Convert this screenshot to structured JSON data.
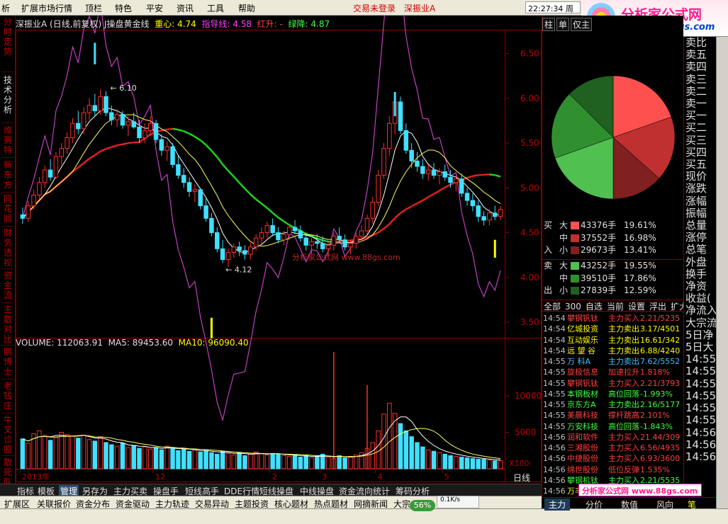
{
  "menu": {
    "items": [
      "析",
      "扩展市场行情",
      "顶栏",
      "特色",
      "平安",
      "资讯",
      "工具",
      "帮助"
    ],
    "trade_status": "交易未登录",
    "stock_label": "深振业A",
    "clock": "22:27:34 周三"
  },
  "logo": {
    "name": "分析家公式网",
    "url": "www.88gs.com"
  },
  "left_tabs": [
    "分时走势",
    "技术分析",
    "维赛特",
    "新东方",
    "同花顺",
    "财务透视",
    "资金流",
    "主散对比",
    "鹏博士",
    "老钱庄",
    "牛叉诊股",
    "散死队",
    "提"
  ],
  "chart_header": {
    "title": "深振业A (日线,前复权) J操盘黄金线",
    "zhongxin_label": "重心:",
    "zhongxin_value": "4.74",
    "zhidao_label": "指导线:",
    "zhidao_value": "4.58",
    "hongsheng_label": "红升:",
    "hongsheng_value": "-",
    "lvjiang_label": "绿降:",
    "lvjiang_value": "4.87"
  },
  "annotations": {
    "high_label": "6.10",
    "low_label": "4.12"
  },
  "watermark": "分析家公式网 www.88gs.com",
  "volume_header": {
    "vol_label": "VOLUME:",
    "vol_value": "112063.91",
    "ma5_label": "MA5:",
    "ma5_value": "89453.60",
    "ma10_label": "MA10:",
    "ma10_value": "96090.40"
  },
  "axis": {
    "price_ticks": [
      "6.50",
      "6.00",
      "5.50",
      "5.00",
      "4.50",
      "4.00",
      "3.50"
    ],
    "volume_ticks": [
      "10000",
      "5000"
    ],
    "volume_unit": "X100",
    "time_labels": [
      "2013年",
      "12",
      "2",
      "3",
      "4",
      "5"
    ],
    "period": "日线"
  },
  "bottom_tabs_1": [
    "指标",
    "模板",
    "管理",
    "另存为",
    "主力买卖",
    "操盘手",
    "短线高手",
    "DDE行情",
    "短线操盘",
    "中线操盘",
    "资金流向统计",
    "筹码分析"
  ],
  "bottom_tabs_1_active": "管理",
  "bottom_tabs_2": [
    "扩展区",
    "关联报价",
    "资金分布",
    "资金驱动",
    "主力轨迹",
    "交易异动",
    "主题投资",
    "核心题材",
    "热点题材",
    "网摘新闻",
    "大宗"
  ],
  "zoom": "56%",
  "net_speed": "0.1K/s",
  "right_tabs": [
    "柱",
    "单",
    "仅主"
  ],
  "flow_buy_side": [
    "买",
    "入"
  ],
  "flow_sell_side": [
    "卖",
    "出"
  ],
  "size_labels": [
    "大",
    "中",
    "小"
  ],
  "flow_buy": [
    {
      "vol": "43376手",
      "pct": "19.61%",
      "color": "#ff5050"
    },
    {
      "vol": "37552手",
      "pct": "16.98%",
      "color": "#c03030"
    },
    {
      "vol": "29673手",
      "pct": "13.41%",
      "color": "#802020"
    }
  ],
  "flow_sell": [
    {
      "vol": "43252手",
      "pct": "19.55%",
      "color": "#50c050"
    },
    {
      "vol": "39510手",
      "pct": "17.86%",
      "color": "#309030"
    },
    {
      "vol": "27839手",
      "pct": "12.59%",
      "color": "#206020"
    }
  ],
  "tick_tabs": [
    "全部",
    "300",
    "自选",
    "当前",
    "设置",
    "浮出",
    "扩大"
  ],
  "ticks": [
    {
      "time": "14:54",
      "name": "攀钢钒钛",
      "type": "主力买入",
      "value": "2.21/5235",
      "color": "#ff4040"
    },
    {
      "time": "14:54",
      "name": "亿城投资",
      "type": "主力卖出",
      "value": "3.17/4501",
      "color": "#ffff00"
    },
    {
      "time": "14:54",
      "name": "互动娱乐",
      "type": "主力卖出",
      "value": "16.61/342",
      "color": "#ffff00"
    },
    {
      "time": "14:54",
      "name": "远 望 谷",
      "type": "主力卖出",
      "value": "6.88/4240",
      "color": "#ffff00"
    },
    {
      "time": "14:55",
      "name": "万  科A",
      "type": "主力卖出",
      "value": "7.62/5552",
      "color": "#40c0ff"
    },
    {
      "time": "14:55",
      "name": "旋极信息",
      "type": "加速拉升",
      "value": "1.818%",
      "color": "#ff4040"
    },
    {
      "time": "14:55",
      "name": "攀钢钒钛",
      "type": "主力买入",
      "value": "2.21/3793",
      "color": "#ff4040"
    },
    {
      "time": "14:55",
      "name": "本钢板材",
      "type": "高位回落",
      "value": "-1.993%",
      "color": "#40ff40"
    },
    {
      "time": "14:55",
      "name": "京东方A",
      "type": "主力卖出",
      "value": "2.16/5177",
      "color": "#40ff40"
    },
    {
      "time": "14:55",
      "name": "美晨科技",
      "type": "撑杆跳高",
      "value": "2.101%",
      "color": "#ff4040"
    },
    {
      "time": "14:55",
      "name": "万安科技",
      "type": "高位回落",
      "value": "-1.843%",
      "color": "#40ff40"
    },
    {
      "time": "14:56",
      "name": "润和软件",
      "type": "主力买入",
      "value": "21.44/309",
      "color": "#ff4040"
    },
    {
      "time": "14:56",
      "name": "三湘股份",
      "type": "主力买入",
      "value": "6.56/4935",
      "color": "#ff4040"
    },
    {
      "time": "14:56",
      "name": "中捷股份",
      "type": "主力买入",
      "value": "6.93/3600",
      "color": "#ff4040"
    },
    {
      "time": "14:56",
      "name": "绵世股份",
      "type": "低位反弹",
      "value": "1.535%",
      "color": "#ff4040"
    },
    {
      "time": "14:56",
      "name": "攀钢机钛",
      "type": "主力买入",
      "value": "2.21/5535",
      "color": "#40ff40"
    },
    {
      "time": "14:56",
      "name": "万丰",
      "type": "",
      "value": "",
      "color": "#ffff00"
    }
  ],
  "far_right_labels": [
    "卖比",
    "卖五",
    "卖四",
    "卖三",
    "卖二",
    "卖一",
    "买一",
    "买二",
    "买三",
    "买四",
    "买五",
    "现价",
    "涨跌",
    "涨幅",
    "振幅",
    "总量",
    "涨停",
    "总笔",
    "外盘",
    "换手",
    "净资",
    "收益(",
    "净流入",
    "大宗流",
    "5日净",
    "5日大",
    "14:55",
    "14:55",
    "14:55",
    "14:55",
    "14:55",
    "14:55",
    "14:56",
    "14:56",
    "14:56"
  ],
  "right_bottom_tabs": [
    "主力",
    "分价",
    "数值",
    "风向",
    "笔"
  ],
  "chart_data": {
    "type": "candlestick",
    "title": "深振业A (日线,前复权) J操盘黄金线",
    "ylim": [
      3.35,
      6.75
    ],
    "candles": [
      [
        4.7,
        4.78,
        4.6,
        4.66
      ],
      [
        4.66,
        4.85,
        4.62,
        4.8
      ],
      [
        4.8,
        4.98,
        4.76,
        4.92
      ],
      [
        4.92,
        5.12,
        4.88,
        5.06
      ],
      [
        5.06,
        5.25,
        5.0,
        5.2
      ],
      [
        5.2,
        5.32,
        5.08,
        5.12
      ],
      [
        5.12,
        5.4,
        5.1,
        5.35
      ],
      [
        5.35,
        5.5,
        5.26,
        5.44
      ],
      [
        5.44,
        5.62,
        5.38,
        5.56
      ],
      [
        5.56,
        5.78,
        5.5,
        5.72
      ],
      [
        5.72,
        5.86,
        5.6,
        5.66
      ],
      [
        5.66,
        5.9,
        5.6,
        5.84
      ],
      [
        5.84,
        6.0,
        5.76,
        5.92
      ],
      [
        5.92,
        6.05,
        5.8,
        5.86
      ],
      [
        5.86,
        6.1,
        5.82,
        6.02
      ],
      [
        6.02,
        6.08,
        5.8,
        5.84
      ],
      [
        5.84,
        5.92,
        5.7,
        5.76
      ],
      [
        5.76,
        5.88,
        5.68,
        5.82
      ],
      [
        5.82,
        5.86,
        5.66,
        5.7
      ],
      [
        5.7,
        5.8,
        5.58,
        5.74
      ],
      [
        5.74,
        5.84,
        5.66,
        5.68
      ],
      [
        5.68,
        5.76,
        5.5,
        5.56
      ],
      [
        5.56,
        5.72,
        5.5,
        5.64
      ],
      [
        5.64,
        5.8,
        5.58,
        5.72
      ],
      [
        5.72,
        5.76,
        5.5,
        5.54
      ],
      [
        5.54,
        5.6,
        5.36,
        5.42
      ],
      [
        5.42,
        5.52,
        5.3,
        5.46
      ],
      [
        5.46,
        5.5,
        5.22,
        5.26
      ],
      [
        5.26,
        5.36,
        5.1,
        5.14
      ],
      [
        5.14,
        5.22,
        5.0,
        5.06
      ],
      [
        5.06,
        5.12,
        4.9,
        4.96
      ],
      [
        4.96,
        5.04,
        4.84,
        4.98
      ],
      [
        4.98,
        5.0,
        4.76,
        4.8
      ],
      [
        4.8,
        4.88,
        4.62,
        4.66
      ],
      [
        4.66,
        4.72,
        4.46,
        4.5
      ],
      [
        4.5,
        4.56,
        4.28,
        4.32
      ],
      [
        4.32,
        4.42,
        4.16,
        4.2
      ],
      [
        4.2,
        4.32,
        4.12,
        4.28
      ],
      [
        4.28,
        4.38,
        4.22,
        4.34
      ],
      [
        4.34,
        4.4,
        4.24,
        4.3
      ],
      [
        4.3,
        4.36,
        4.2,
        4.26
      ],
      [
        4.26,
        4.38,
        4.2,
        4.34
      ],
      [
        4.34,
        4.48,
        4.3,
        4.44
      ],
      [
        4.44,
        4.56,
        4.38,
        4.5
      ],
      [
        4.5,
        4.62,
        4.44,
        4.58
      ],
      [
        4.58,
        4.66,
        4.46,
        4.5
      ],
      [
        4.5,
        4.56,
        4.38,
        4.42
      ],
      [
        4.42,
        4.52,
        4.36,
        4.48
      ],
      [
        4.48,
        4.6,
        4.42,
        4.56
      ],
      [
        4.56,
        4.64,
        4.48,
        4.52
      ],
      [
        4.52,
        4.58,
        4.4,
        4.44
      ],
      [
        4.44,
        4.5,
        4.3,
        4.36
      ],
      [
        4.36,
        4.44,
        4.26,
        4.4
      ],
      [
        4.4,
        4.48,
        4.32,
        4.38
      ],
      [
        4.38,
        4.46,
        4.28,
        4.32
      ],
      [
        4.32,
        4.4,
        4.22,
        4.36
      ],
      [
        4.36,
        4.5,
        4.3,
        4.46
      ],
      [
        4.46,
        4.56,
        4.38,
        4.42
      ],
      [
        4.42,
        4.48,
        4.3,
        4.34
      ],
      [
        4.34,
        4.42,
        4.26,
        4.38
      ],
      [
        4.38,
        4.5,
        4.32,
        4.46
      ],
      [
        4.46,
        4.58,
        4.4,
        4.52
      ],
      [
        4.52,
        4.7,
        4.48,
        4.66
      ],
      [
        4.66,
        4.9,
        4.6,
        4.84
      ],
      [
        4.84,
        5.2,
        4.8,
        5.14
      ],
      [
        5.14,
        5.5,
        5.1,
        5.44
      ],
      [
        5.44,
        5.8,
        5.36,
        5.72
      ],
      [
        5.72,
        6.04,
        5.6,
        5.96
      ],
      [
        5.96,
        6.02,
        5.6,
        5.64
      ],
      [
        5.64,
        5.72,
        5.38,
        5.42
      ],
      [
        5.42,
        5.5,
        5.22,
        5.3
      ],
      [
        5.3,
        5.4,
        5.18,
        5.24
      ],
      [
        5.24,
        5.32,
        5.1,
        5.16
      ],
      [
        5.16,
        5.26,
        5.08,
        5.2
      ],
      [
        5.2,
        5.28,
        5.1,
        5.14
      ],
      [
        5.14,
        5.22,
        5.04,
        5.18
      ],
      [
        5.18,
        5.26,
        5.08,
        5.12
      ],
      [
        5.12,
        5.2,
        5.0,
        5.06
      ],
      [
        5.06,
        5.14,
        4.96,
        5.1
      ],
      [
        5.1,
        5.16,
        4.9,
        4.94
      ],
      [
        4.94,
        5.0,
        4.8,
        4.86
      ],
      [
        4.86,
        4.94,
        4.74,
        4.8
      ],
      [
        4.8,
        4.86,
        4.62,
        4.68
      ],
      [
        4.68,
        4.74,
        4.58,
        4.64
      ],
      [
        4.64,
        4.76,
        4.58,
        4.72
      ],
      [
        4.72,
        4.8,
        4.64,
        4.68
      ],
      [
        4.68,
        4.8,
        4.64,
        4.76
      ]
    ],
    "volume_ylim": [
      0,
      16500
    ],
    "volumes": [
      4100,
      3500,
      4800,
      5200,
      4600,
      3900,
      4300,
      5000,
      4700,
      4500,
      4200,
      4600,
      4000,
      3800,
      4400,
      3600,
      3300,
      3100,
      3500,
      2900,
      3200,
      2800,
      3000,
      2700,
      2900,
      2600,
      3100,
      2800,
      2500,
      2700,
      2400,
      2600,
      2300,
      2500,
      2200,
      2000,
      2400,
      2100,
      1900,
      2200,
      1800,
      2000,
      2300,
      2100,
      1900,
      2100,
      2000,
      1800,
      1700,
      1900,
      1600,
      1800,
      1500,
      1700,
      2000,
      1600,
      1400,
      1800,
      1500,
      1700,
      1900,
      2200,
      2800,
      3600,
      5200,
      7500,
      9000,
      7600,
      6200,
      5200,
      4400,
      3600,
      3000,
      2600,
      2400,
      2200,
      2000,
      1800,
      1700,
      1600,
      1500,
      1400,
      1300,
      1300,
      1200,
      1100,
      1100
    ],
    "tall_volume_spikes": [
      [
        56,
        16000
      ],
      [
        62,
        11500
      ]
    ]
  }
}
